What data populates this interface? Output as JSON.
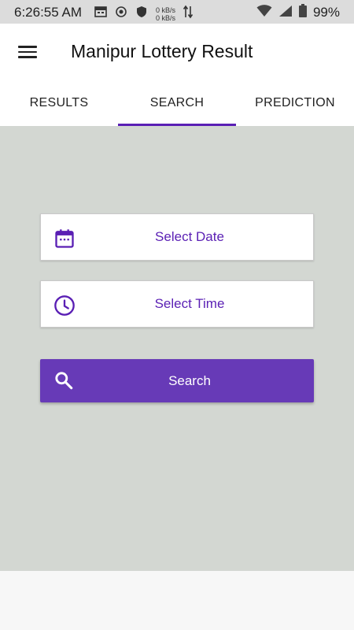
{
  "status_bar": {
    "time": "6:26:55 AM",
    "net_up": "0 kB/s",
    "net_down": "0 kB/s",
    "battery": "99%",
    "icons": [
      "calendar-icon",
      "record-icon",
      "shield-icon",
      "data-arrows-icon",
      "wifi-icon",
      "signal-icon",
      "battery-icon"
    ]
  },
  "app_bar": {
    "title": "Manipur Lottery Result",
    "menu_icon": "hamburger-menu-icon"
  },
  "tabs": [
    {
      "label": "RESULTS",
      "active": false
    },
    {
      "label": "SEARCH",
      "active": true
    },
    {
      "label": "PREDICTION",
      "active": false
    }
  ],
  "search_form": {
    "date_label": "Select Date",
    "time_label": "Select Time",
    "search_label": "Search"
  },
  "colors": {
    "accent": "#5a1fb4",
    "button_bg": "#673ab7",
    "content_bg": "#d3d7d2"
  }
}
